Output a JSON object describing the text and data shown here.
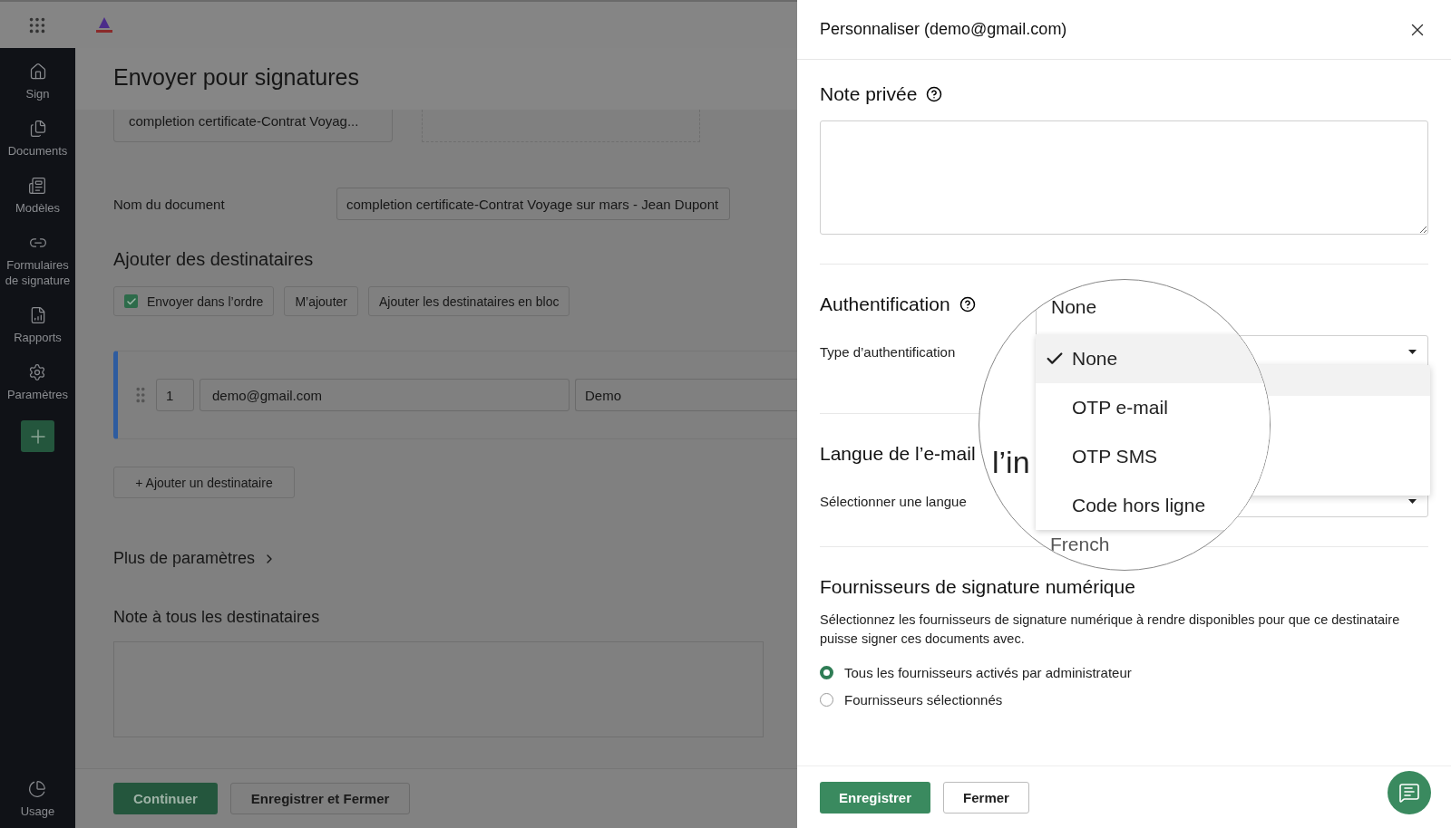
{
  "sidebar": {
    "items": [
      {
        "kind": "home",
        "label": "Sign"
      },
      {
        "kind": "documents",
        "label": "Documents"
      },
      {
        "kind": "templates",
        "label": "Modèles"
      },
      {
        "kind": "link",
        "label": "Formulaires de signature"
      },
      {
        "kind": "reports",
        "label": "Rapports"
      },
      {
        "kind": "settings",
        "label": "Paramètres"
      }
    ],
    "usage": "Usage"
  },
  "page": {
    "title": "Envoyer pour signatures",
    "document_card": "completion certificate-Contrat Voyag...",
    "document_name": {
      "label": "Nom du document",
      "value": "completion certificate-Contrat Voyage sur mars - Jean Dupont"
    },
    "recipients_title": "Ajouter des destinataires",
    "options": [
      {
        "kind": "checkbox",
        "label": "Envoyer dans l’ordre",
        "checked": true
      },
      {
        "kind": "button",
        "label": "M’ajouter"
      },
      {
        "kind": "button",
        "label": "Ajouter les destinataires en bloc"
      }
    ],
    "recipient": {
      "order": "1",
      "email": "demo@gmail.com",
      "name": "Demo"
    },
    "add_recipient": "+ Ajouter un destinataire",
    "more_settings": "Plus de paramètres",
    "note_title": "Note à tous les destinataires",
    "buttons": [
      {
        "kind": "primary",
        "label": "Continuer"
      },
      {
        "kind": "secondary",
        "label": "Enregistrer et Fermer"
      }
    ]
  },
  "panel": {
    "title": "Personnaliser (demo@gmail.com)",
    "private_note": {
      "title": "Note privée"
    },
    "auth": {
      "title": "Authentification",
      "label": "Type d’authentification"
    },
    "language": {
      "title": "Langue de l’e-mail",
      "label": "Sélectionner une langue"
    },
    "providers": {
      "title": "Fournisseurs de signature numérique",
      "description": "Sélectionnez les fournisseurs de signature numérique à rendre disponibles pour que ce destinataire puisse signer ces documents avec.",
      "options": [
        {
          "label": "Tous les fournisseurs activés par administrateur",
          "selected": true
        },
        {
          "label": "Fournisseurs sélectionnés",
          "selected": false
        }
      ]
    },
    "buttons": [
      {
        "kind": "primary",
        "label": "Enregistrer"
      },
      {
        "kind": "secondary",
        "label": "Fermer"
      }
    ]
  },
  "magnifier": {
    "field_value": "None",
    "fragment": "l’in",
    "behind_text": "French",
    "options": [
      {
        "label": "None",
        "selected": true
      },
      {
        "label": "OTP e-mail",
        "selected": false
      },
      {
        "label": "OTP SMS",
        "selected": false
      },
      {
        "label": "Code hors ligne",
        "selected": false
      }
    ]
  }
}
